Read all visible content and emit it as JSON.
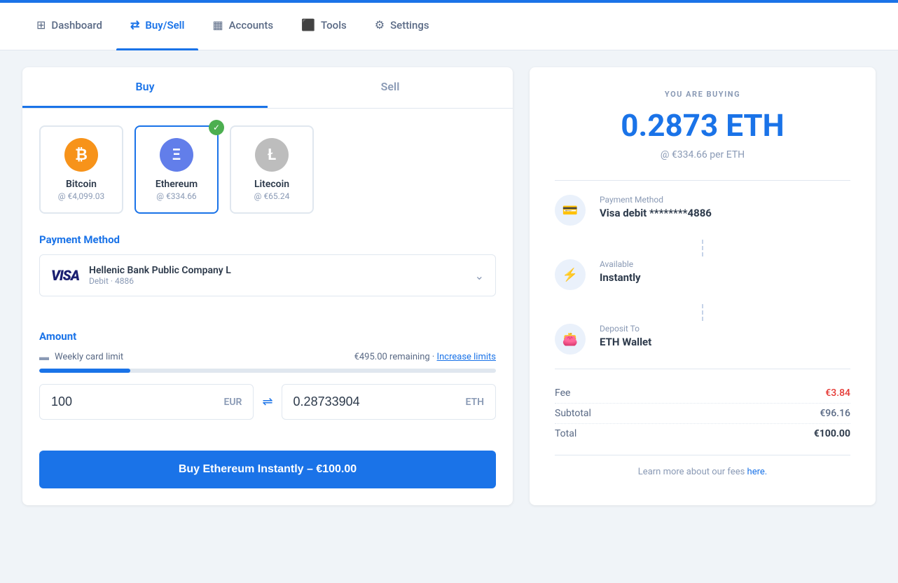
{
  "nav": {
    "items": [
      {
        "id": "dashboard",
        "label": "Dashboard",
        "icon": "⊞",
        "active": false
      },
      {
        "id": "buy-sell",
        "label": "Buy/Sell",
        "icon": "⇄",
        "active": true
      },
      {
        "id": "accounts",
        "label": "Accounts",
        "icon": "▦",
        "active": false
      },
      {
        "id": "tools",
        "label": "Tools",
        "icon": "⬛",
        "active": false
      },
      {
        "id": "settings",
        "label": "Settings",
        "icon": "⚙",
        "active": false
      }
    ]
  },
  "tabs": {
    "buy_label": "Buy",
    "sell_label": "Sell",
    "active": "buy"
  },
  "cryptos": [
    {
      "id": "btc",
      "name": "Bitcoin",
      "price": "@ €4,099.03",
      "icon": "₿",
      "selected": false,
      "iconClass": "btc"
    },
    {
      "id": "eth",
      "name": "Ethereum",
      "price": "@ €334.66",
      "icon": "Ξ",
      "selected": true,
      "iconClass": "eth"
    },
    {
      "id": "ltc",
      "name": "Litecoin",
      "price": "@ €65.24",
      "icon": "Ł",
      "selected": false,
      "iconClass": "ltc"
    }
  ],
  "payment": {
    "section_label": "Payment Method",
    "bank_name": "Hellenic Bank Public Company L",
    "card_type": "Debit · 4886"
  },
  "amount": {
    "section_label": "Amount",
    "weekly_limit_label": "Weekly card limit",
    "remaining_text": "€495.00 remaining",
    "increase_limits_label": "Increase limits",
    "progress_percent": 20,
    "eur_value": "100",
    "eur_currency": "EUR",
    "eth_value": "0.28733904",
    "eth_currency": "ETH"
  },
  "buy_button": {
    "label": "Buy Ethereum Instantly – €100.00"
  },
  "summary": {
    "you_are_buying": "YOU ARE BUYING",
    "amount": "0.2873 ETH",
    "rate": "@ €334.66 per ETH",
    "payment_method_label": "Payment Method",
    "payment_method_value": "Visa debit ********4886",
    "available_label": "Available",
    "available_value": "Instantly",
    "deposit_label": "Deposit To",
    "deposit_value": "ETH Wallet",
    "fee_label": "Fee",
    "fee_amount": "€3.84",
    "subtotal_label": "Subtotal",
    "subtotal_amount": "€96.16",
    "total_label": "Total",
    "total_amount": "€100.00",
    "learn_more_text": "Learn more about our fees",
    "learn_more_link": "here."
  }
}
